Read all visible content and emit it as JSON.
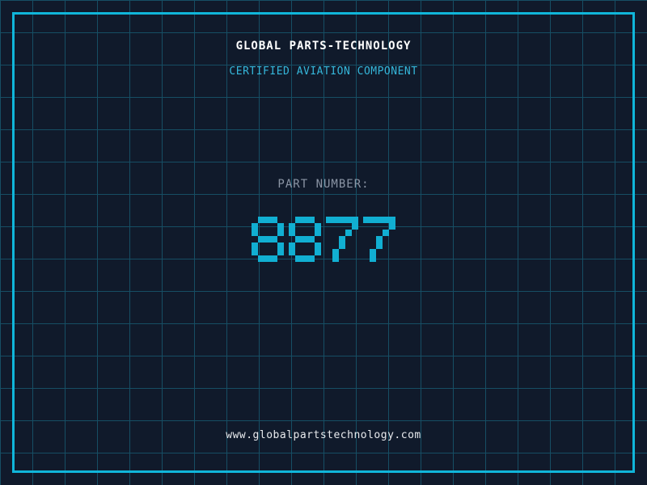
{
  "header": {
    "title": "GLOBAL PARTS-TECHNOLOGY",
    "subtitle": "CERTIFIED AVIATION COMPONENT"
  },
  "part": {
    "label": "PART NUMBER:",
    "number": "8877"
  },
  "footer": {
    "url": "www.globalpartstechnology.com"
  },
  "colors": {
    "bg": "#101A2B",
    "grid": "#164E64",
    "frame": "#10B6DA",
    "title": "#FFFFFF",
    "accent": "#35B7DB",
    "label": "#8B95A5",
    "digits": "#11AFD2",
    "url": "#E8EAED"
  }
}
